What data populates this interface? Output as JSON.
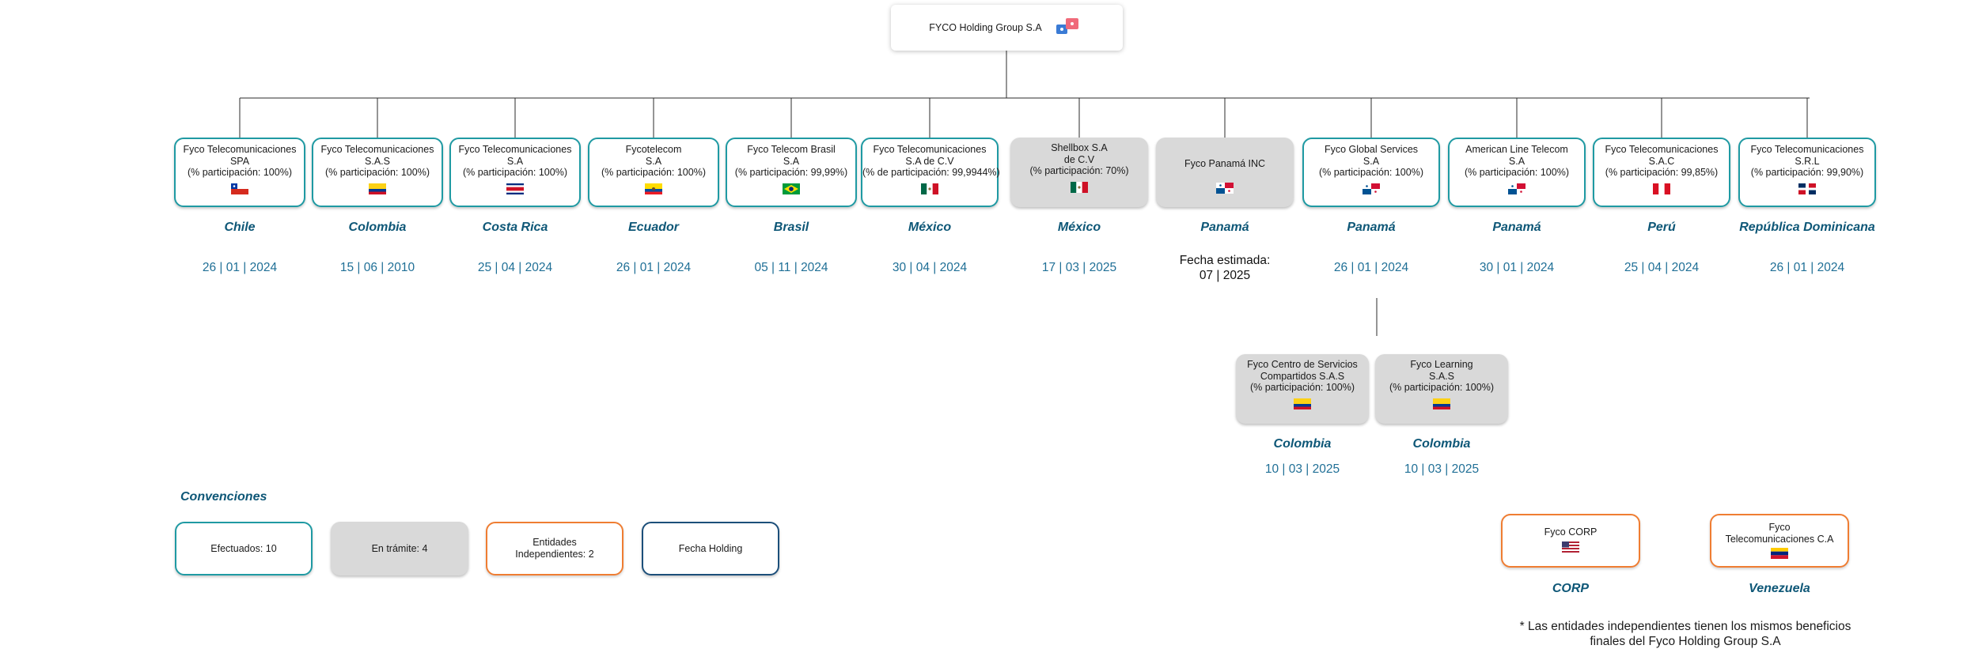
{
  "holding": {
    "name": "FYCO Holding Group S.A",
    "flag": "panama"
  },
  "entities": [
    {
      "id": "chile",
      "lines": [
        "Fyco Telecomunicaciones",
        "SPA",
        "(% participación: 100%)"
      ],
      "flag": "chile",
      "status": "done",
      "country": "Chile",
      "date": "26 | 01 | 2024"
    },
    {
      "id": "colombia",
      "lines": [
        "Fyco Telecomunicaciones",
        "S.A.S",
        "(% participación: 100%)"
      ],
      "flag": "colombia",
      "status": "done",
      "country": "Colombia",
      "date": "15 | 06 | 2010"
    },
    {
      "id": "costa-rica",
      "lines": [
        "Fyco Telecomunicaciones",
        "S.A",
        "(% participación: 100%)"
      ],
      "flag": "costarica",
      "status": "done",
      "country": "Costa Rica",
      "date": "25 | 04 | 2024"
    },
    {
      "id": "ecuador",
      "lines": [
        "Fycotelecom",
        "S.A",
        "(% participación: 100%)"
      ],
      "flag": "ecuador",
      "status": "done",
      "country": "Ecuador",
      "date": "26 | 01 | 2024"
    },
    {
      "id": "brasil",
      "lines": [
        "Fyco Telecom Brasil",
        "S.A",
        "(% participación: 99,99%)"
      ],
      "flag": "brazil",
      "status": "done",
      "country": "Brasil",
      "date": "05 | 11 | 2024"
    },
    {
      "id": "mexico-1",
      "lines": [
        "Fyco Telecomunicaciones",
        "S.A de C.V",
        "(% de participación: 99,9944%)"
      ],
      "flag": "mexico",
      "status": "done",
      "country": "México",
      "date": "30 | 04 | 2024"
    },
    {
      "id": "mexico-2",
      "lines": [
        "Shellbox S.A",
        "de C.V",
        "(% participación: 70%)"
      ],
      "flag": "mexico",
      "status": "pending",
      "country": "México",
      "date": "17 | 03 | 2025"
    },
    {
      "id": "panama-1",
      "lines": [
        "Fyco Panamá INC"
      ],
      "flag": "panama",
      "status": "pending",
      "country": "Panamá",
      "date": "Fecha estimada:\n07 | 2025"
    },
    {
      "id": "panama-2",
      "lines": [
        "Fyco Global Services",
        "S.A",
        "(% participación: 100%)"
      ],
      "flag": "panama",
      "status": "done",
      "country": "Panamá",
      "date": "26 | 01 | 2024"
    },
    {
      "id": "panama-3",
      "lines": [
        "American Line Telecom",
        "S.A",
        "(% participación: 100%)"
      ],
      "flag": "panama",
      "status": "done",
      "country": "Panamá",
      "date": "30 | 01 | 2024"
    },
    {
      "id": "peru",
      "lines": [
        "Fyco Telecomunicaciones",
        "S.A.C",
        "(% participación: 99,85%)"
      ],
      "flag": "peru",
      "status": "done",
      "country": "Perú",
      "date": "25 | 04 | 2024"
    },
    {
      "id": "dominicana",
      "lines": [
        "Fyco Telecomunicaciones",
        "S.R.L",
        "(% participación: 99,90%)"
      ],
      "flag": "dominican",
      "status": "done",
      "country": "República Dominicana",
      "date": "26 | 01 | 2024"
    }
  ],
  "subsidiaries": [
    {
      "id": "centro-servicios",
      "lines": [
        "Fyco Centro de Servicios",
        "Compartidos S.A.S",
        "(% participación: 100%)"
      ],
      "flag": "colombia",
      "status": "pending",
      "country": "Colombia",
      "date": "10 | 03 | 2025"
    },
    {
      "id": "learning",
      "lines": [
        "Fyco Learning",
        "S.A.S",
        "(% participación: 100%)"
      ],
      "flag": "colombia",
      "status": "pending",
      "country": "Colombia",
      "date": "10 | 03 | 2025"
    }
  ],
  "independents": [
    {
      "id": "corp",
      "lines": [
        "Fyco CORP"
      ],
      "flag": "usa",
      "country": "CORP"
    },
    {
      "id": "venezuela",
      "lines": [
        "Fyco",
        "Telecomunicaciones C.A"
      ],
      "flag": "venezuela",
      "country": "Venezuela"
    }
  ],
  "legend": {
    "title": "Convenciones",
    "items": [
      {
        "label": "Efectuados: 10",
        "style": "done"
      },
      {
        "label": "En trámite: 4",
        "style": "pending"
      },
      {
        "label": "Entidades\nIndependientes: 2",
        "style": "indep"
      },
      {
        "label": "Fecha Holding",
        "style": "holding"
      }
    ]
  },
  "note": "* Las entidades independientes tienen los mismos beneficios\nfinales del Fyco Holding Group S.A",
  "colors": {
    "done": "#1f9aa3",
    "pending": "#d9d9d9",
    "indep": "#ef7d32",
    "holding": "#1c4f7a",
    "country_text": "#0e5777",
    "date_text": "#1f6f96"
  }
}
